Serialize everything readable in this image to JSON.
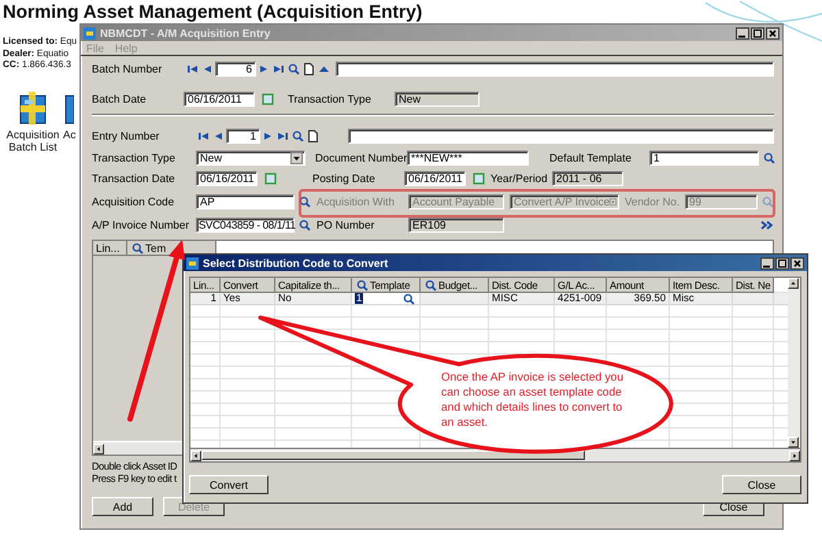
{
  "page_title": "Norming Asset Management (Acquisition Entry)",
  "license_lines": [
    "**Licensed to:** Equ",
    "**Dealer:** Equatio",
    "**CC:** 1.866.436.3"
  ],
  "desktop_icons": [
    {
      "label": "Acquisition Batch List"
    },
    {
      "label": "Ac"
    }
  ],
  "main_window": {
    "title": "NBMCDT - A/M Acquisition Entry",
    "active": false,
    "menu": [
      {
        "label": "File",
        "disabled": true
      },
      {
        "label": "Help",
        "disabled": true
      }
    ],
    "batch_number_label": "Batch Number",
    "batch_number": "6",
    "batch_date_label": "Batch Date",
    "batch_date": "06/16/2011",
    "batch_type_label": "Transaction Type",
    "batch_type": "New",
    "entry_number_label": "Entry Number",
    "entry_number": "1",
    "transaction_type_label": "Transaction Type",
    "transaction_type": "New",
    "document_number_label": "Document Number",
    "document_number": "***NEW***",
    "default_template_label": "Default Template",
    "default_template": "1",
    "transaction_date_label": "Transaction Date",
    "transaction_date": "06/16/2011",
    "posting_date_label": "Posting Date",
    "posting_date": "06/16/2011",
    "year_period_label": "Year/Period",
    "year_period": "2011 - 06",
    "acquisition_code_label": "Acquisition Code",
    "acquisition_code": "AP",
    "acquisition_with": {
      "disabled": true,
      "label": "Acquisition With",
      "value": "Account Payable",
      "mode": "Convert A/P Invoice",
      "vendor_label": "Vendor No.",
      "vendor": "99"
    },
    "ap_invoice_label": "A/P Invoice Number",
    "ap_invoice": "SVC043859 - 08/1/11",
    "po_number_label": "PO Number",
    "po_number": "ER109",
    "grid_columns": [
      {
        "label": "Lin...",
        "lookup": false
      },
      {
        "label": "Tem",
        "lookup": true
      }
    ],
    "hints": [
      "Double click Asset ID",
      "Press F9 key to edit t"
    ],
    "buttons": [
      {
        "label": "Add",
        "disabled": false
      },
      {
        "label": "Delete",
        "disabled": true
      }
    ],
    "close_button": "Close"
  },
  "dialog": {
    "title": "Select Distribution Code to Convert",
    "active": true,
    "columns": [
      {
        "label": "Lin...",
        "lookup": false
      },
      {
        "label": "Convert",
        "lookup": false
      },
      {
        "label": "Capitalize th...",
        "lookup": false
      },
      {
        "label": "Template",
        "lookup": true
      },
      {
        "label": "Budget...",
        "lookup": true
      },
      {
        "label": "Dist. Code",
        "lookup": false
      },
      {
        "label": "G/L Ac...",
        "lookup": false
      },
      {
        "label": "Amount",
        "lookup": false
      },
      {
        "label": "Item Desc.",
        "lookup": false
      },
      {
        "label": "Dist. Ne",
        "lookup": false
      }
    ],
    "rows": [
      {
        "line": "1",
        "convert": "Yes",
        "capitalize": "No",
        "template": "1",
        "dist_code": "MISC",
        "gl_account": "4251-009",
        "amount": "369.50",
        "item_desc": "Misc"
      }
    ],
    "convert_button": "Convert",
    "close_button": "Close"
  },
  "callout": "Once the AP invoice is selected you can choose an asset template code and which details lines to convert to an asset."
}
